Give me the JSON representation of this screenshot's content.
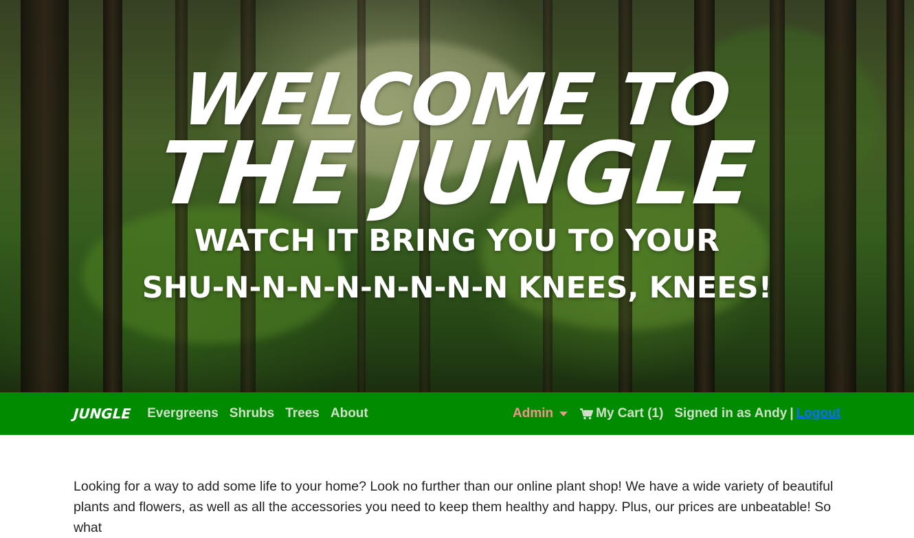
{
  "hero": {
    "line1": "WELCOME TO",
    "line2": "THE JUNGLE",
    "line3": "WATCH IT BRING YOU TO YOUR",
    "line4": "SHU-N-N-N-N-N-N-N-N KNEES, KNEES!"
  },
  "navbar": {
    "brand": "JUNGLE",
    "links": [
      "Evergreens",
      "Shrubs",
      "Trees",
      "About"
    ],
    "admin_label": "Admin",
    "cart_label": "My Cart (1)",
    "signed_in_text": "Signed in as Andy",
    "separator": "|",
    "logout_label": "Logout",
    "bg_color": "#008b00",
    "admin_color": "#f1948a",
    "logout_color": "#0d6efd"
  },
  "main": {
    "intro": "Looking for a way to add some life to your home? Look no further than our online plant shop! We have a wide variety of beautiful plants and flowers, as well as all the accessories you need to keep them healthy and happy. Plus, our prices are unbeatable! So what"
  }
}
